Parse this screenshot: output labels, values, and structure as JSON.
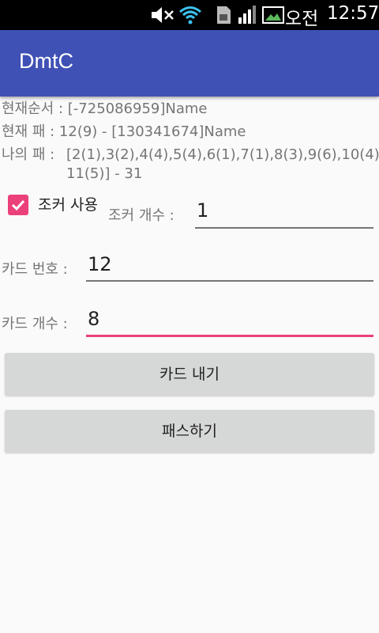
{
  "status_bar": {
    "icons": [
      "mute-icon",
      "wifi-icon",
      "sd-card-icon",
      "signal-icon",
      "image-notification-icon"
    ],
    "ampm": "오전",
    "time": "12:57"
  },
  "app_bar": {
    "title": "DmtC"
  },
  "info": {
    "current_order_label": "현재순서 :",
    "current_order_value": "[-725086959]Name",
    "current_card_label": "현재 패 :",
    "current_card_value": "12(9) - [130341674]Name",
    "my_cards_label": "나의 패 :",
    "my_cards_line1": "[2(1),3(2),4(4),5(4),6(1),7(1),8(3),9(6),10(4),",
    "my_cards_line2": "11(5)] - 31"
  },
  "joker": {
    "checkbox_label": "조커 사용",
    "checked": true,
    "count_label": "조커 개수 :",
    "count_value": "1"
  },
  "card_number": {
    "label": "카드 번호 :",
    "value": "12"
  },
  "card_count": {
    "label": "카드 개수 :",
    "value": "8"
  },
  "buttons": {
    "play": "카드 내기",
    "pass": "패스하기"
  },
  "colors": {
    "primary": "#3f51b5",
    "accent": "#ec407a",
    "button": "#d6d7d7"
  }
}
